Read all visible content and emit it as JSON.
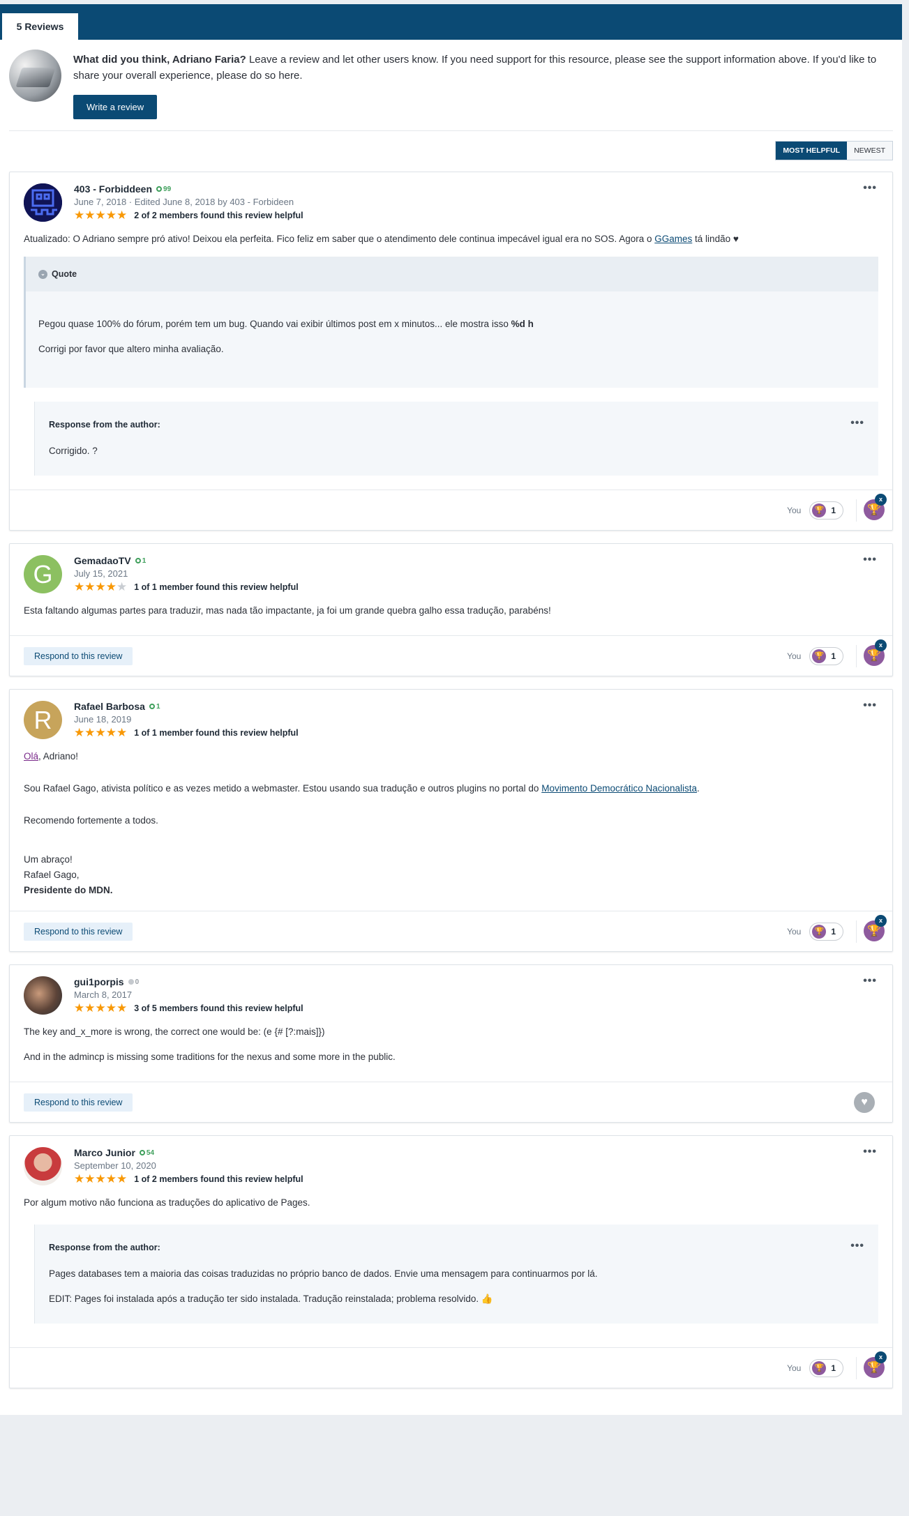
{
  "tab": {
    "label": "5 Reviews"
  },
  "prompt": {
    "question": "What did you think, Adriano Faria?",
    "text": " Leave a review and let other users know. If you need support for this resource, please see the support information above. If you'd like to share your overall experience, please do so here.",
    "button": "Write a review"
  },
  "sort": {
    "active": "MOST HELPFUL",
    "inactive": "NEWEST"
  },
  "common": {
    "respond": "Respond to this review",
    "you": "You",
    "response_title": "Response from the author:",
    "quote_label": "Quote",
    "more": "•••"
  },
  "reviews": [
    {
      "author": "403 - Forbiddeen",
      "rep": "99",
      "date": "June 7, 2018 · Edited June 8, 2018 by 403 - Forbideen",
      "stars": 5,
      "helpful": "2 of 2 members found this review helpful",
      "text_pre": "Atualizado: O Adriano sempre pró ativo! Deixou ela perfeita. Fico feliz em saber que o atendimento dele continua impecável igual era no SOS. Agora o ",
      "text_link": "GGames",
      "text_post": " tá lindão ♥",
      "quote_line1_pre": "Pegou quase 100% do fórum, porém tem um bug. Quando vai exibir últimos post em x minutos... ele mostra isso ",
      "quote_line1_bold": "%d h",
      "quote_line2": "Corrigi por favor que altero minha avaliação.",
      "response": "Corrigido. ?",
      "reaction_count": "1"
    },
    {
      "author": "GemadaoTV",
      "rep": "1",
      "avatar_letter": "G",
      "avatar_color": "#8cc061",
      "date": "July 15, 2021",
      "stars": 4,
      "helpful": "1 of 1 member found this review helpful",
      "text": "Esta faltando algumas partes para traduzir, mas nada tão impactante, ja foi um grande quebra galho essa tradução, parabéns!",
      "reaction_count": "1"
    },
    {
      "author": "Rafael Barbosa",
      "rep": "1",
      "avatar_letter": "R",
      "avatar_color": "#c7a45b",
      "date": "June 18, 2019",
      "stars": 5,
      "helpful": "1 of 1 member found this review helpful",
      "greeting_link": "Olá",
      "greeting_rest": ", Adriano!",
      "para2_pre": "Sou Rafael Gago, ativista político e as vezes metido a webmaster. Estou usando sua tradução e outros plugins no portal do ",
      "para2_link": "Movimento Democrático Nacionalista",
      "para2_post": ".",
      "para3": "Recomendo fortemente a todos.",
      "sign1": "Um abraço!",
      "sign2": "Rafael Gago,",
      "sign3": "Presidente do MDN.",
      "reaction_count": "1"
    },
    {
      "author": "gui1porpis",
      "rep": "0",
      "date": "March 8, 2017",
      "stars": 5,
      "helpful": "3 of 5 members found this review helpful",
      "para1": "The key and_x_more is wrong, the correct one would be: (e {# [?:mais]})",
      "para2": "And in the admincp is missing some traditions for the nexus and some more in the public."
    },
    {
      "author": "Marco Junior",
      "rep": "54",
      "date": "September 10, 2020",
      "stars": 5,
      "helpful": "1 of 2 members found this review helpful",
      "text": "Por algum motivo não funciona as traduções do aplicativo de Pages.",
      "response1": "Pages databases tem a maioria das coisas traduzidas no próprio banco de dados. Envie uma mensagem para continuarmos por lá.",
      "response2": "EDIT: Pages foi instalada após a tradução ter sido instalada. Tradução reinstalada; problema resolvido. 👍",
      "reaction_count": "1"
    }
  ],
  "colors": {
    "brand": "#0b4a74",
    "star": "#f89806",
    "reputation": "#3e9f5b",
    "trophy": "#8e5a9e"
  }
}
